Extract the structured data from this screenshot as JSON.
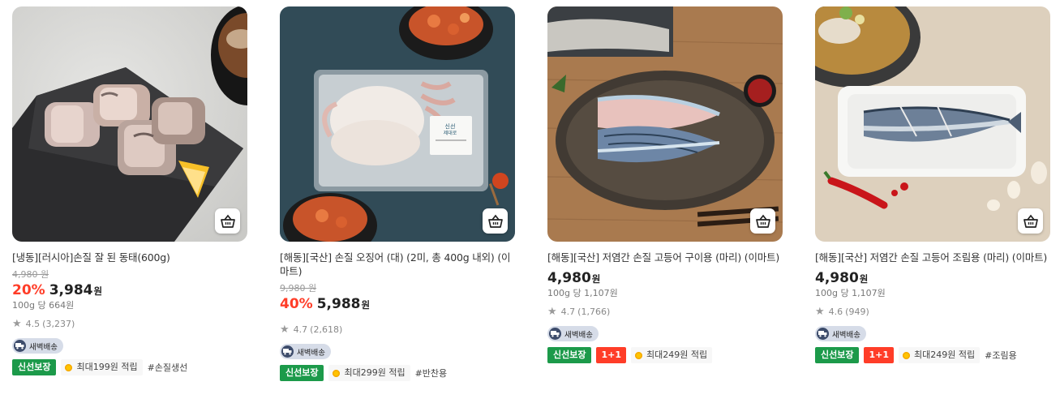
{
  "products": [
    {
      "title": "[냉동][러시아]손질 잘 된 동태(600g)",
      "original_price": "4,980 원",
      "discount": "20%",
      "price": "3,984",
      "currency": "원",
      "unit_price": "100g 당 664원",
      "rating": "4.5",
      "reviews": "(3,237)",
      "delivery_label": "새벽배송",
      "fresh_badge": "신선보장",
      "one_plus_one": "",
      "points": "최대199원 적립",
      "tag": "#손질생선"
    },
    {
      "title": "[해동][국산] 손질 오징어 (대) (2미, 총 400g 내외) (이마트)",
      "original_price": "9,980 원",
      "discount": "40%",
      "price": "5,988",
      "currency": "원",
      "unit_price": "",
      "rating": "4.7",
      "reviews": "(2,618)",
      "delivery_label": "새벽배송",
      "fresh_badge": "신선보장",
      "one_plus_one": "",
      "points": "최대299원 적립",
      "tag": "#반찬용"
    },
    {
      "title": "[해동][국산] 저염간 손질 고등어 구이용 (마리) (이마트)",
      "original_price": "",
      "discount": "",
      "price": "4,980",
      "currency": "원",
      "unit_price": "100g 당 1,107원",
      "rating": "4.7",
      "reviews": "(1,766)",
      "delivery_label": "새벽배송",
      "fresh_badge": "신선보장",
      "one_plus_one": "1+1",
      "points": "최대249원 적립",
      "tag": ""
    },
    {
      "title": "[해동][국산] 저염간 손질 고등어 조림용 (마리) (이마트)",
      "original_price": "",
      "discount": "",
      "price": "4,980",
      "currency": "원",
      "unit_price": "100g 당 1,107원",
      "rating": "4.6",
      "reviews": "(949)",
      "delivery_label": "새벽배송",
      "fresh_badge": "신선보장",
      "one_plus_one": "1+1",
      "points": "최대249원 적립",
      "tag": "#조림용"
    }
  ],
  "product_image_labels": [
    "신선",
    "제대로"
  ],
  "icons": {
    "cart": "basket-icon",
    "star": "star-icon",
    "truck": "truck-icon",
    "coin": "coin-icon"
  },
  "colors": {
    "discount": "#ff3d28",
    "fresh_badge": "#1c9a4a",
    "one_plus_one": "#ff3d28",
    "dawn_delivery_bg": "#d6dce8"
  }
}
